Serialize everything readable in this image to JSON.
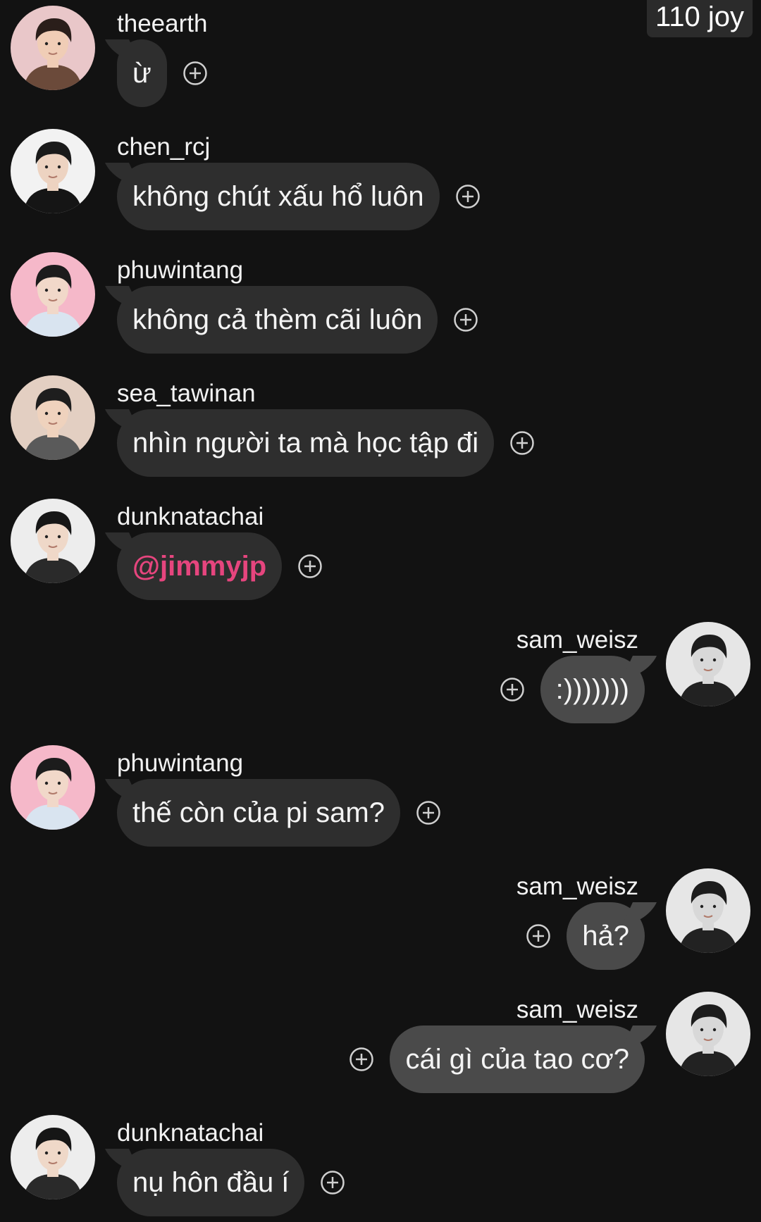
{
  "header": {
    "badge": "110 joy"
  },
  "messages": [
    {
      "side": "left",
      "user": "theearth",
      "text": "ừ",
      "avatar": "avatar-theearth"
    },
    {
      "side": "left",
      "user": "chen_rcj",
      "text": "không chút xấu hổ luôn",
      "avatar": "avatar-chen_rcj"
    },
    {
      "side": "left",
      "user": "phuwintang",
      "text": "không cả thèm cãi luôn",
      "avatar": "avatar-phuwintang"
    },
    {
      "side": "left",
      "user": "sea_tawinan",
      "text": "nhìn người ta mà học tập đi",
      "avatar": "avatar-sea_tawinan"
    },
    {
      "side": "left",
      "user": "dunknatachai",
      "text": "@jimmyjp",
      "mention": true,
      "avatar": "avatar-dunknatachai"
    },
    {
      "side": "right",
      "user": "sam_weisz",
      "text": ":)))))))",
      "avatar": "avatar-sam_weisz"
    },
    {
      "side": "left",
      "user": "phuwintang",
      "text": "thế còn của pi sam?",
      "avatar": "avatar-phuwintang"
    },
    {
      "side": "right",
      "user": "sam_weisz",
      "text": "hả?",
      "avatar": "avatar-sam_weisz"
    },
    {
      "side": "right",
      "user": "sam_weisz",
      "text": "cái gì của tao cơ?",
      "avatar": "avatar-sam_weisz"
    },
    {
      "side": "left",
      "user": "dunknatachai",
      "text": "nụ hôn đầu í",
      "avatar": "avatar-dunknatachai"
    }
  ],
  "icons": {
    "react": "add-reaction-icon"
  },
  "colors": {
    "background": "#121212",
    "bubble_other": "#2e2e2e",
    "bubble_self": "#4a4a4a",
    "mention": "#e6457e"
  }
}
